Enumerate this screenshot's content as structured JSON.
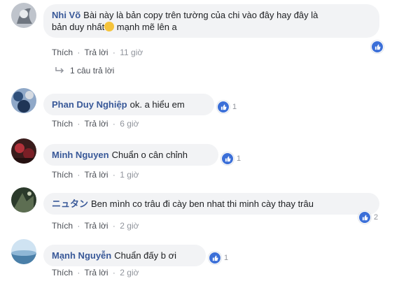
{
  "labels": {
    "like": "Thích",
    "reply": "Trả lời",
    "dot": "·"
  },
  "comments": [
    {
      "author": "Nhi Võ",
      "text_line1": "Bài này là bản copy trên tường của chi vào đây hay đây là",
      "text_line2_a": "bản duy nhất",
      "text_line2_b": " mạnh mẽ lên a",
      "time": "11 giờ",
      "likes": "",
      "replies": "1 câu trả lời"
    },
    {
      "author": "Phan Duy Nghiệp",
      "text": "ok. a hiểu em",
      "time": "6 giờ",
      "likes": "1"
    },
    {
      "author": "Minh Nguyen",
      "text": "Chuẩn o cân chỉnh",
      "time": "1 giờ",
      "likes": "1"
    },
    {
      "author": "ニュタン",
      "text": "Ben mình co trâu đi cày ben nhat thi minh cày thay trâu",
      "time": "2 giờ",
      "likes": "2"
    },
    {
      "author": "Mạnh Nguyễn",
      "text": "Chuẩn đấy b ơi",
      "time": "2 giờ",
      "likes": "1"
    }
  ],
  "colors": {
    "author": "#385898",
    "bubble": "#f2f3f5",
    "like": "#3b6fd8",
    "meta": "#90949c"
  }
}
